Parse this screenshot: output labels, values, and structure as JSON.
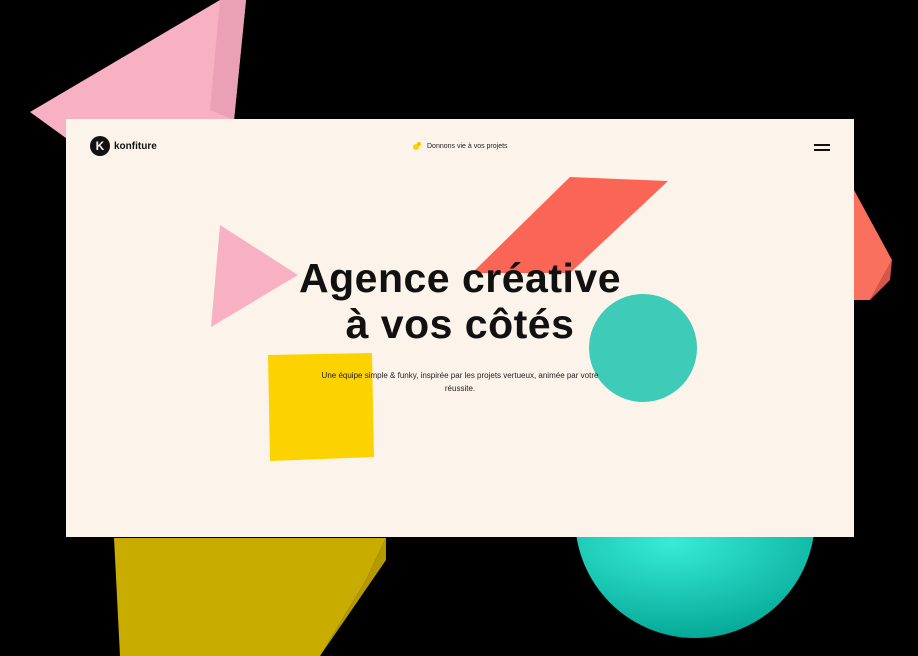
{
  "header": {
    "logo_mark": "K",
    "logo_text": "konfiture",
    "tagline": "Donnons vie à vos projets",
    "tagline_icon": "sparkle-icon",
    "menu_icon": "hamburger-menu-icon"
  },
  "hero": {
    "title_line1": "Agence créative",
    "title_line2": "à vos côtés",
    "subtitle": "Une équipe simple & funky, inspirée par les projets vertueux, animée par votre réussite."
  },
  "colors": {
    "page_bg": "#fcf4ea",
    "backdrop": "#000000",
    "pink": "#f7b1c3",
    "coral": "#fa6556",
    "teal": "#3ecbb7",
    "yellow": "#fcd201",
    "text": "#111111"
  }
}
